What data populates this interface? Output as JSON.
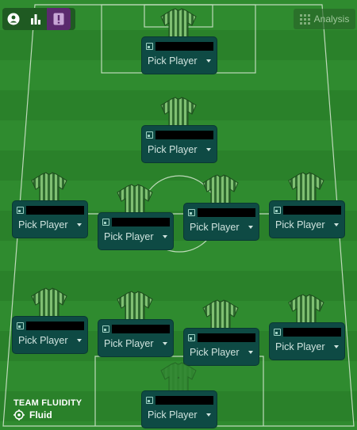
{
  "toolbar": {
    "buttons": [
      {
        "icon": "person-circle-icon",
        "active": false
      },
      {
        "icon": "bar-chart-icon",
        "active": false
      },
      {
        "icon": "alert-icon",
        "active": true
      }
    ]
  },
  "analysis": {
    "label": "Analysis",
    "icon": "grid-icon"
  },
  "pick_label": "Pick Player",
  "team_fluidity": {
    "title": "TEAM FLUIDITY",
    "value": "Fluid"
  },
  "colors": {
    "pitch": "#2e8a2e",
    "card": "#0e4a44",
    "accent": "#5b2a6e"
  }
}
